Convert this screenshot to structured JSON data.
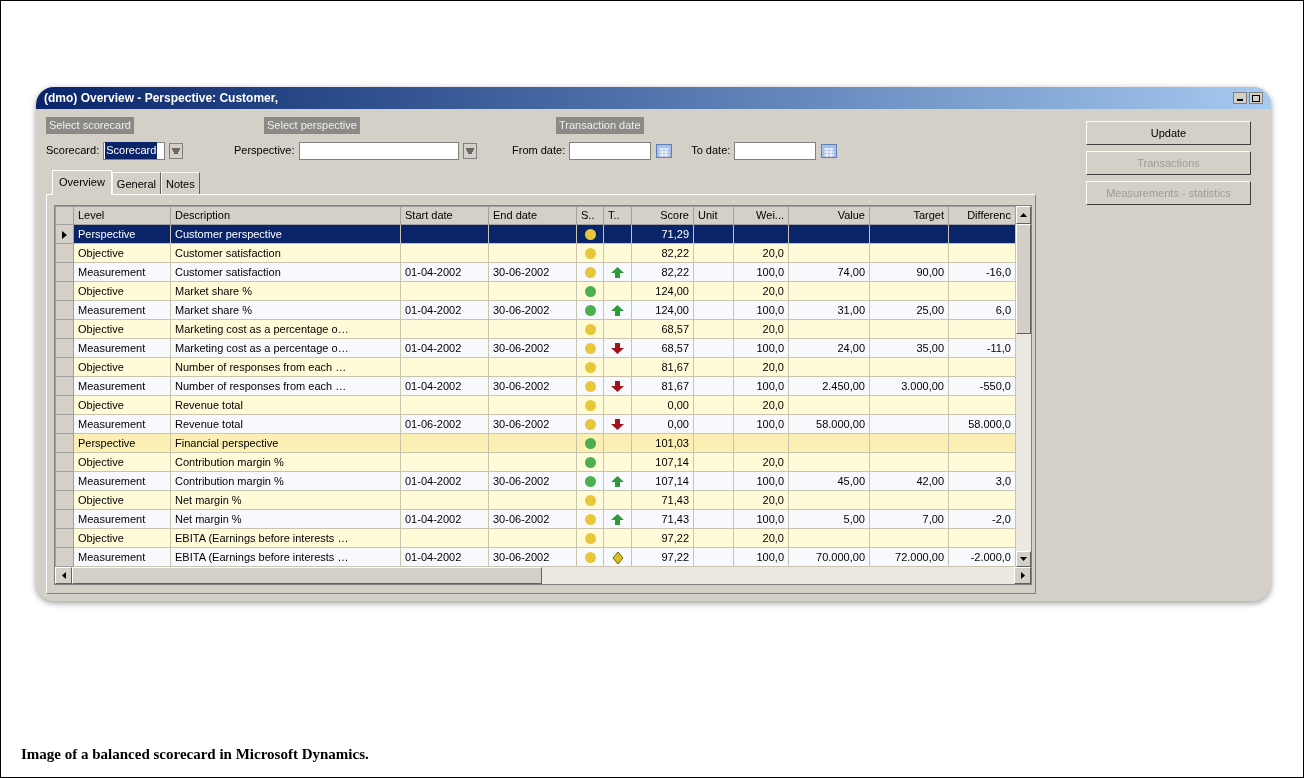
{
  "window": {
    "title": "(dmo) Overview - Perspective: Customer,"
  },
  "filters": {
    "groups": [
      "Select scorecard",
      "Select perspective",
      "Transaction date"
    ],
    "scorecard": {
      "label": "Scorecard:",
      "value": "Scorecard"
    },
    "perspective": {
      "label": "Perspective:"
    },
    "from_date": {
      "label": "From date:"
    },
    "to_date": {
      "label": "To date:"
    }
  },
  "buttons": [
    {
      "label": "Update",
      "disabled": false
    },
    {
      "label": "Transactions",
      "disabled": true
    },
    {
      "label": "Measurements - statistics",
      "disabled": true
    }
  ],
  "tabs": [
    {
      "label": "Overview",
      "selected": true
    },
    {
      "label": "General",
      "selected": false
    },
    {
      "label": "Notes",
      "selected": false
    }
  ],
  "table": {
    "columns": [
      "Level",
      "Description",
      "Start date",
      "End date",
      "S..",
      "T..",
      "Score",
      "Unit",
      "Wei...",
      "Value",
      "Target",
      "Differenc"
    ],
    "rows": [
      {
        "kind": "perspective",
        "selected": true,
        "level": "Perspective",
        "description": "Customer perspective",
        "color": "#e8c83a",
        "score": "71,29"
      },
      {
        "kind": "objective",
        "selected": false,
        "level": "Objective",
        "description": "Customer satisfaction",
        "color": "#e8c83a",
        "score": "82,22",
        "weight": "20,0"
      },
      {
        "kind": "measurement",
        "selected": false,
        "level": "Measurement",
        "description": "Customer satisfaction",
        "start": "01-04-2002",
        "end": "30-06-2002",
        "color": "#e8c83a",
        "trend": {
          "kind": "up"
        },
        "score": "82,22",
        "weight": "100,0",
        "value": "74,00",
        "target": "90,00",
        "difference": "-16,0"
      },
      {
        "kind": "objective",
        "selected": false,
        "level": "Objective",
        "description": "Market share %",
        "color": "#4caf50",
        "score": "124,00",
        "weight": "20,0"
      },
      {
        "kind": "measurement",
        "selected": false,
        "level": "Measurement",
        "description": "Market share %",
        "start": "01-04-2002",
        "end": "30-06-2002",
        "color": "#4caf50",
        "trend": {
          "kind": "up"
        },
        "score": "124,00",
        "weight": "100,0",
        "value": "31,00",
        "target": "25,00",
        "difference": "6,0"
      },
      {
        "kind": "objective",
        "selected": false,
        "level": "Objective",
        "description": "Marketing cost as a percentage o…",
        "color": "#e8c83a",
        "score": "68,57",
        "weight": "20,0"
      },
      {
        "kind": "measurement",
        "selected": false,
        "level": "Measurement",
        "description": "Marketing cost as a percentage o…",
        "start": "01-04-2002",
        "end": "30-06-2002",
        "color": "#e8c83a",
        "trend": {
          "kind": "down"
        },
        "score": "68,57",
        "weight": "100,0",
        "value": "24,00",
        "target": "35,00",
        "difference": "-11,0"
      },
      {
        "kind": "objective",
        "selected": false,
        "level": "Objective",
        "description": "Number of responses from each …",
        "color": "#e8c83a",
        "score": "81,67",
        "weight": "20,0"
      },
      {
        "kind": "measurement",
        "selected": false,
        "level": "Measurement",
        "description": "Number of responses from each …",
        "start": "01-04-2002",
        "end": "30-06-2002",
        "color": "#e8c83a",
        "trend": {
          "kind": "down"
        },
        "score": "81,67",
        "weight": "100,0",
        "value": "2.450,00",
        "target": "3.000,00",
        "difference": "-550,0"
      },
      {
        "kind": "objective",
        "selected": false,
        "level": "Objective",
        "description": "Revenue total",
        "color": "#e8c83a",
        "score": "0,00",
        "weight": "20,0"
      },
      {
        "kind": "measurement",
        "selected": false,
        "level": "Measurement",
        "description": "Revenue total",
        "start": "01-06-2002",
        "end": "30-06-2002",
        "color": "#e8c83a",
        "trend": {
          "kind": "down"
        },
        "score": "0,00",
        "weight": "100,0",
        "value": "58.000,00",
        "difference": "58.000,0"
      },
      {
        "kind": "perspective",
        "selected": false,
        "level": "Perspective",
        "description": "Financial perspective",
        "color": "#4caf50",
        "score": "101,03"
      },
      {
        "kind": "objective",
        "selected": false,
        "level": "Objective",
        "description": "Contribution margin %",
        "color": "#4caf50",
        "score": "107,14",
        "weight": "20,0"
      },
      {
        "kind": "measurement",
        "selected": false,
        "level": "Measurement",
        "description": "Contribution margin %",
        "start": "01-04-2002",
        "end": "30-06-2002",
        "color": "#4caf50",
        "trend": {
          "kind": "up"
        },
        "score": "107,14",
        "weight": "100,0",
        "value": "45,00",
        "target": "42,00",
        "difference": "3,0"
      },
      {
        "kind": "objective",
        "selected": false,
        "level": "Objective",
        "description": "Net margin %",
        "color": "#e8c83a",
        "score": "71,43",
        "weight": "20,0"
      },
      {
        "kind": "measurement",
        "selected": false,
        "level": "Measurement",
        "description": "Net margin %",
        "start": "01-04-2002",
        "end": "30-06-2002",
        "color": "#e8c83a",
        "trend": {
          "kind": "up"
        },
        "score": "71,43",
        "weight": "100,0",
        "value": "5,00",
        "target": "7,00",
        "difference": "-2,0"
      },
      {
        "kind": "objective",
        "selected": false,
        "level": "Objective",
        "description": "EBITA (Earnings before interests …",
        "color": "#e8c83a",
        "score": "97,22",
        "weight": "20,0"
      },
      {
        "kind": "measurement",
        "selected": false,
        "level": "Measurement",
        "description": "EBITA (Earnings before interests …",
        "start": "01-04-2002",
        "end": "30-06-2002",
        "color": "#e8c83a",
        "trend": {
          "kind": "flat"
        },
        "score": "97,22",
        "weight": "100,0",
        "value": "70.000,00",
        "target": "72.000,00",
        "difference": "-2.000,0"
      }
    ]
  },
  "caption": "Image of a balanced scorecard in Microsoft Dynamics."
}
